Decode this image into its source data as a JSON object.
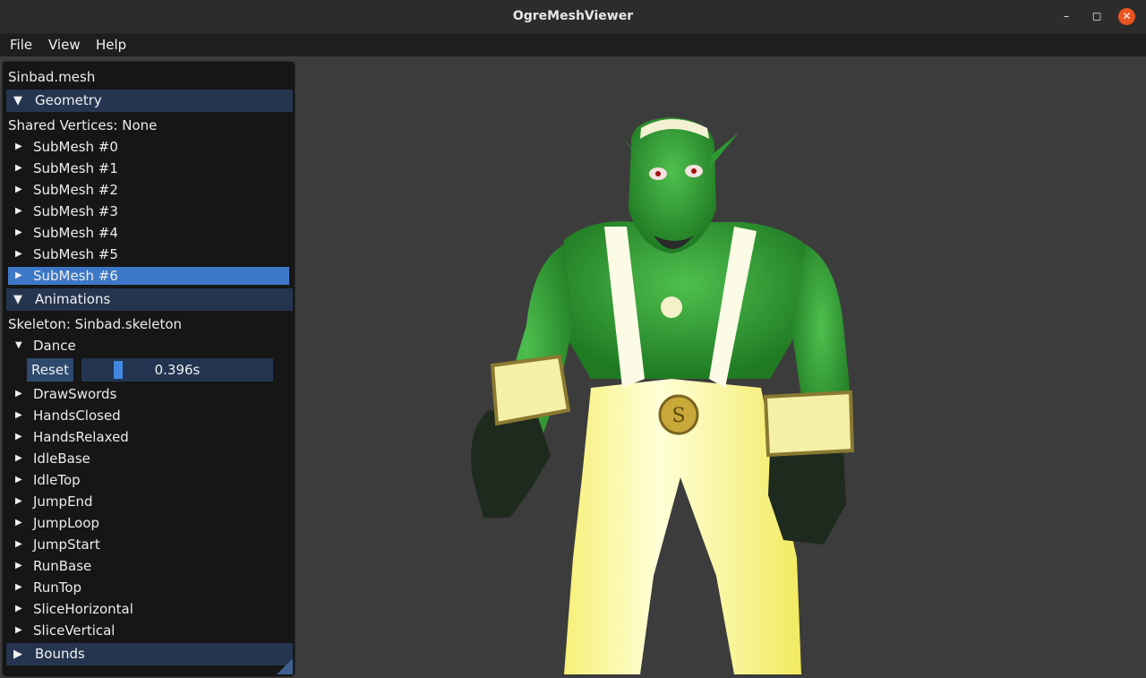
{
  "window": {
    "title": "OgreMeshViewer"
  },
  "menu": {
    "file": "File",
    "view": "View",
    "help": "Help"
  },
  "panel": {
    "mesh_name": "Sinbad.mesh",
    "geometry": {
      "header": "Geometry",
      "shared_vertices": "Shared Vertices: None",
      "submeshes": [
        "SubMesh #0",
        "SubMesh #1",
        "SubMesh #2",
        "SubMesh #3",
        "SubMesh #4",
        "SubMesh #5",
        "SubMesh #6"
      ],
      "selected": "SubMesh #6"
    },
    "animations": {
      "header": "Animations",
      "skeleton": "Skeleton: Sinbad.skeleton",
      "expanded": "Dance",
      "reset_label": "Reset",
      "time_value": "0.396s",
      "list": [
        "DrawSwords",
        "HandsClosed",
        "HandsRelaxed",
        "IdleBase",
        "IdleTop",
        "JumpEnd",
        "JumpLoop",
        "JumpStart",
        "RunBase",
        "RunTop",
        "SliceHorizontal",
        "SliceVertical"
      ]
    },
    "bounds": {
      "header": "Bounds"
    }
  },
  "colors": {
    "accent": "#3d78c8",
    "header": "#25354f",
    "close": "#e95420",
    "viewport_bg": "#3c3c3c"
  },
  "icons": {
    "expanded": "triangle-down-icon",
    "collapsed": "triangle-right-icon"
  }
}
